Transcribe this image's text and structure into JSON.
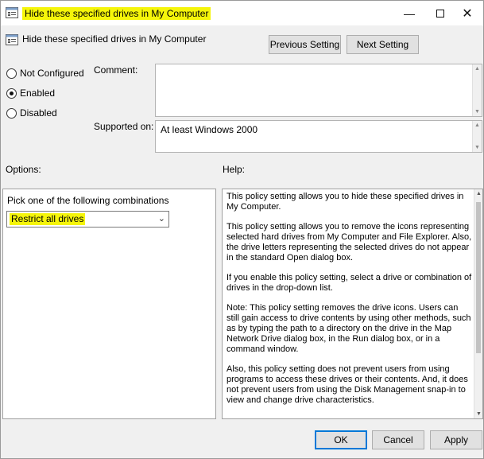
{
  "window": {
    "title": "Hide these specified drives in My Computer"
  },
  "header": {
    "setting_name": "Hide these specified drives in My Computer",
    "previous_label": "Previous Setting",
    "next_label": "Next Setting"
  },
  "state": {
    "not_configured": "Not Configured",
    "enabled": "Enabled",
    "disabled": "Disabled",
    "selected": "enabled"
  },
  "comment": {
    "label": "Comment:",
    "value": ""
  },
  "supported": {
    "label": "Supported on:",
    "value": "At least Windows 2000"
  },
  "options": {
    "label": "Options:",
    "pick_label": "Pick one of the following combinations",
    "selected_value": "Restrict all drives"
  },
  "help": {
    "label": "Help:",
    "paragraphs": [
      "This policy setting allows you to hide these specified drives in My Computer.",
      "This policy setting allows you to remove the icons representing selected hard drives from My Computer and File Explorer. Also, the drive letters representing the selected drives do not appear in the standard Open dialog box.",
      "If you enable this policy setting, select a drive or combination of drives in the drop-down list.",
      "Note: This policy setting removes the drive icons. Users can still gain access to drive contents by using other methods, such as by typing the path to a directory on the drive in the Map Network Drive dialog box, in the Run dialog box, or in a command window.",
      "Also, this policy setting does not prevent users from using programs to access these drives or their contents. And, it does not prevent users from using the Disk Management snap-in to view and change drive characteristics."
    ]
  },
  "footer": {
    "ok_label": "OK",
    "cancel_label": "Cancel",
    "apply_label": "Apply"
  },
  "colors": {
    "highlight": "#f5f50a",
    "accent": "#0078d7"
  }
}
